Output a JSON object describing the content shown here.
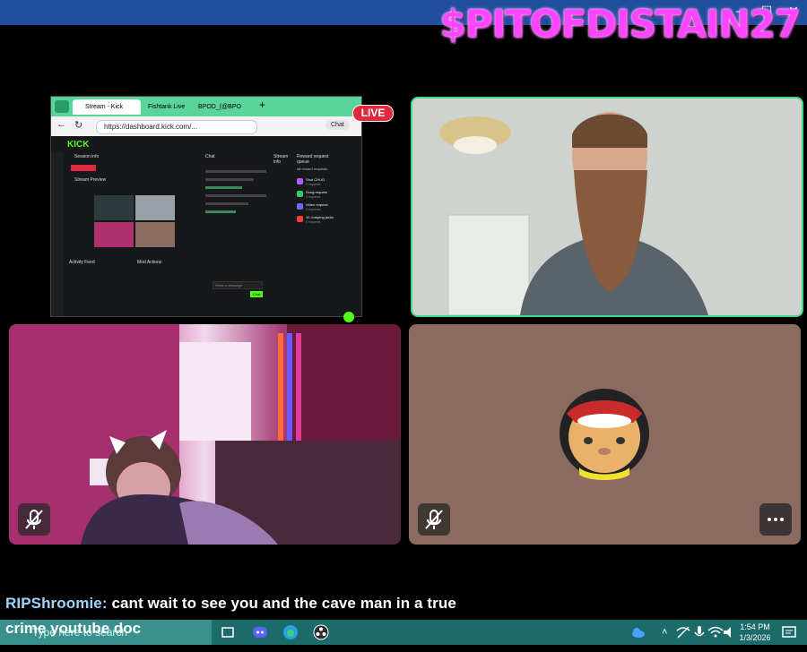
{
  "window": {
    "brand": "$PITOFDISTAIN27"
  },
  "stream_overlay": {
    "live_badge": "LIVE"
  },
  "browser": {
    "tabs": [
      "Stream - Kick",
      "Fishtank Live",
      "BPOD_(@BPO"
    ],
    "url": "https://dashboard.kick.com/...",
    "chat_button": "Chat"
  },
  "dashboard": {
    "logo": "KICK",
    "session_info": "Session info",
    "stream_preview": "Stream Preview",
    "chat_header": "Chat",
    "stream_info": "Stream info",
    "reward_queue": "Reward request queue",
    "all_rewards": "All reward requests",
    "rewards": [
      {
        "label": "Shot CHUG",
        "count": "0 requests",
        "color": "#b85cff"
      },
      {
        "label": "Song request",
        "count": "0 requests",
        "color": "#2ecf6a"
      },
      {
        "label": "Video request",
        "count": "0 requests",
        "color": "#6a6aff"
      },
      {
        "label": "10 Jumping jacks",
        "count": "0 requests",
        "color": "#ff3b3b"
      }
    ],
    "activity_feed": "Activity Feed",
    "mod_actions": "Mod Actions",
    "send_message": "Send a message",
    "chat_send": "Chat"
  },
  "chat_overlay": {
    "username": "RIPShroomie:",
    "message": "cant wait to see you and the cave man in a true",
    "message_cont": "crime youtube doc"
  },
  "taskbar": {
    "search_placeholder": "Type here to search",
    "time": "1:54 PM",
    "date": "1/3/2026"
  }
}
